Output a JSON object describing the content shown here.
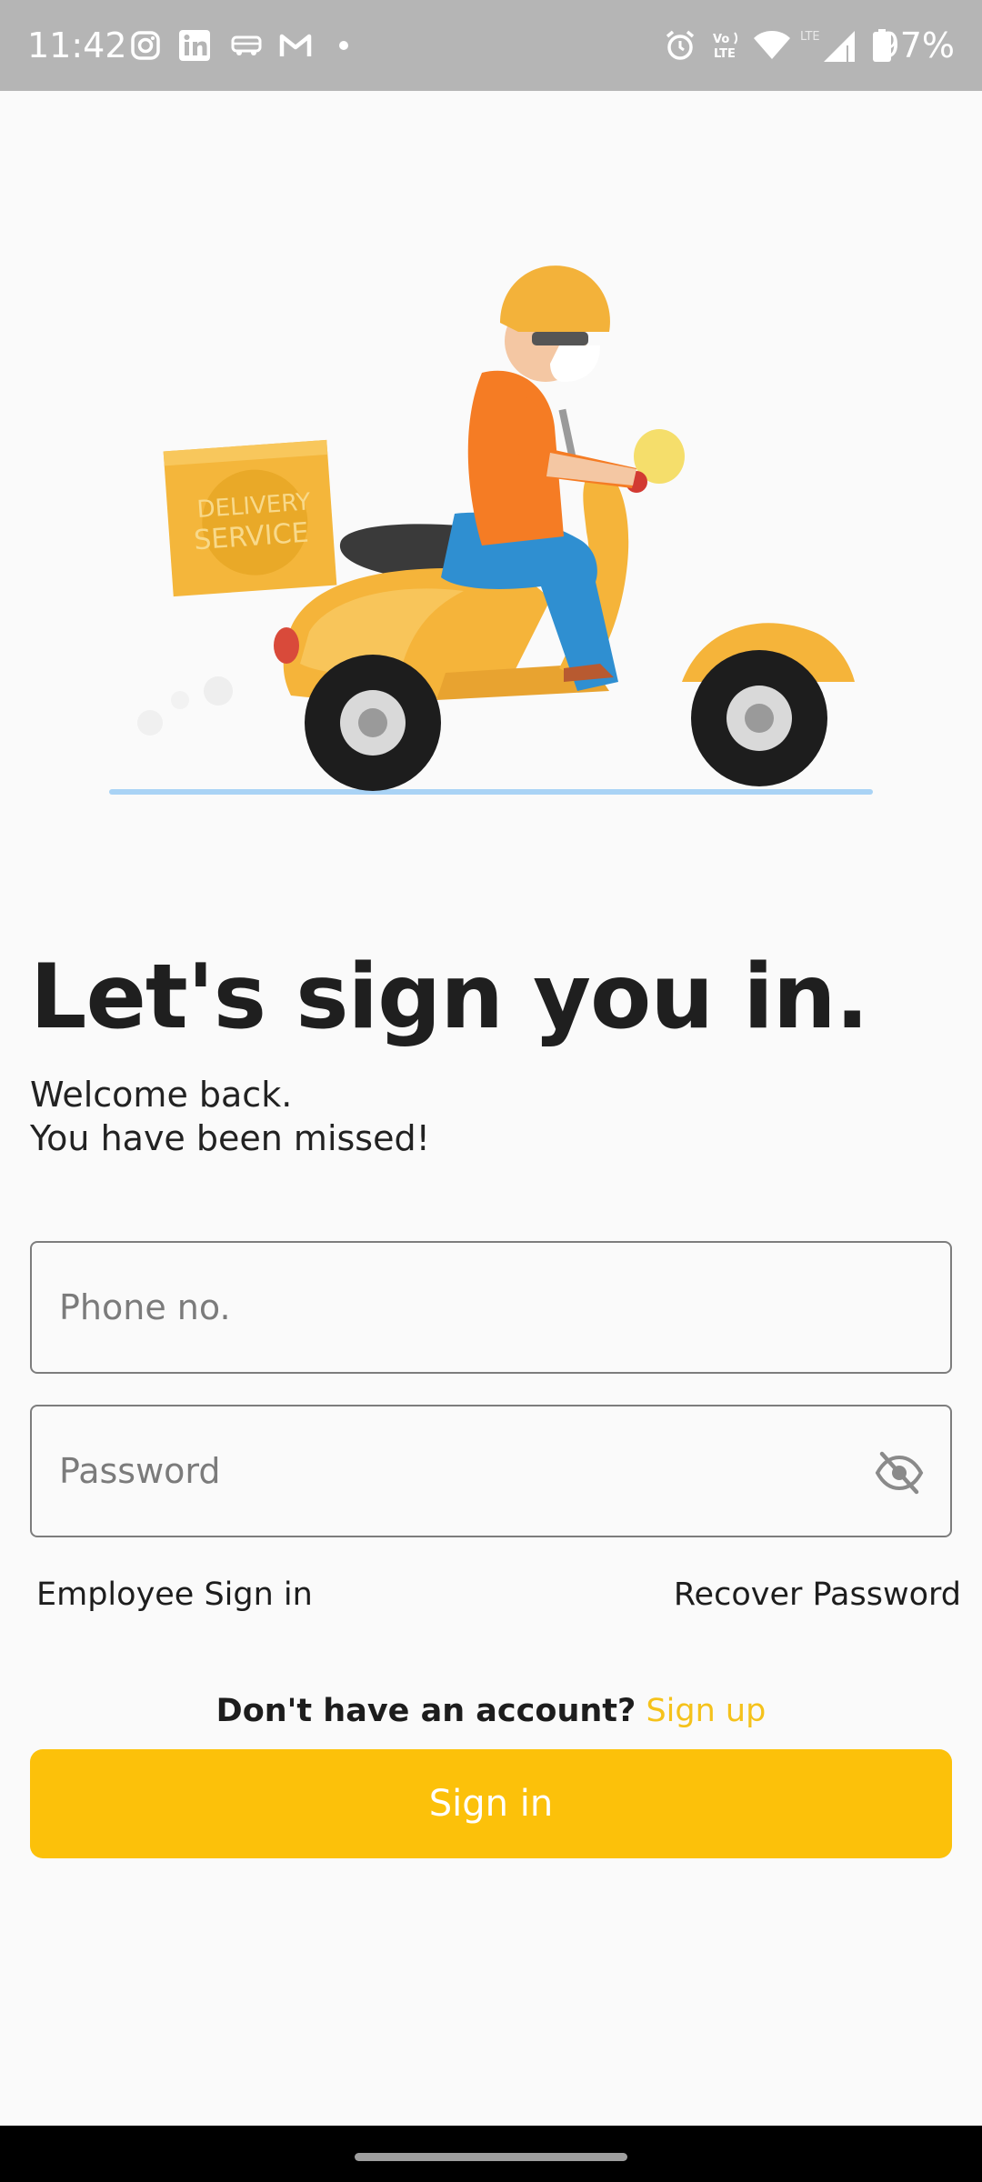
{
  "status_bar": {
    "time": "11:42",
    "battery_percent": "97%",
    "left_icons": [
      "instagram-icon",
      "linkedin-icon",
      "bus-icon",
      "gmail-icon",
      "dot-icon"
    ],
    "right_icons": [
      "alarm-icon",
      "volte-icon",
      "wifi-icon",
      "lte-signal-icon",
      "battery-icon"
    ]
  },
  "illustration": {
    "box_text_line1": "DELIVERY",
    "box_text_line2": "SERVICE"
  },
  "header": {
    "title": "Let's sign you in.",
    "subtitle_line1": "Welcome back.",
    "subtitle_line2": "You have been missed!"
  },
  "form": {
    "phone_placeholder": "Phone no.",
    "phone_value": "",
    "password_placeholder": "Password",
    "password_value": "",
    "employee_link": "Employee Sign in",
    "recover_link": "Recover Password",
    "signup_prefix": "Don't have an account?",
    "signup_link": "Sign up",
    "signin_button": "Sign in"
  },
  "colors": {
    "accent": "#fcc10a",
    "signup_link": "#f5c21b",
    "background": "#fafafa",
    "status_bar": "#b5b5b5"
  }
}
